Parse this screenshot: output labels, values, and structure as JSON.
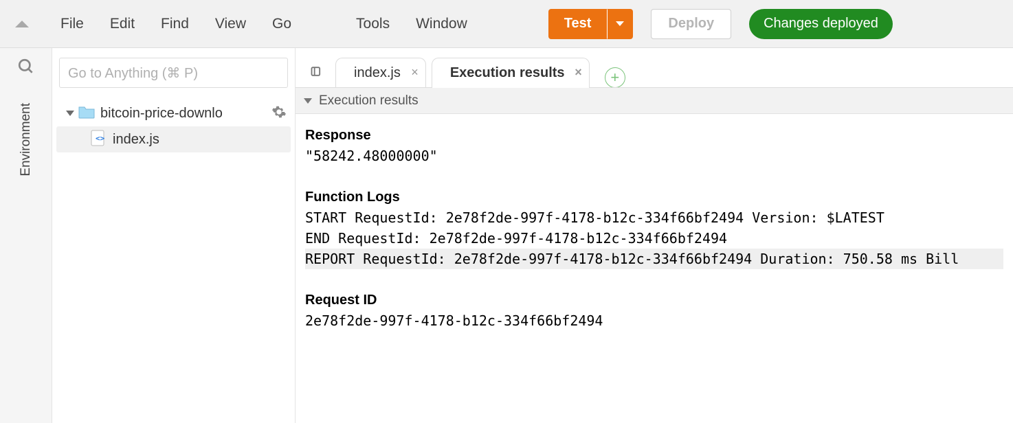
{
  "toolbar": {
    "menus": [
      "File",
      "Edit",
      "Find",
      "View",
      "Go",
      "Tools",
      "Window"
    ],
    "test_label": "Test",
    "deploy_label": "Deploy",
    "status_label": "Changes deployed"
  },
  "sidebar": {
    "tab_label": "Environment",
    "goto_placeholder": "Go to Anything (⌘ P)",
    "tree": {
      "folder": "bitcoin-price-downlo",
      "file": "index.js"
    }
  },
  "tabs": {
    "items": [
      {
        "label": "index.js",
        "active": false
      },
      {
        "label": "Execution results",
        "active": true
      }
    ]
  },
  "panel": {
    "header": "Execution results",
    "response_title": "Response",
    "response_body": "\"58242.48000000\"",
    "logs_title": "Function Logs",
    "logs": [
      "START RequestId: 2e78f2de-997f-4178-b12c-334f66bf2494 Version: $LATEST",
      "END RequestId: 2e78f2de-997f-4178-b12c-334f66bf2494",
      "REPORT RequestId: 2e78f2de-997f-4178-b12c-334f66bf2494  Duration: 750.58 ms Bill"
    ],
    "request_id_title": "Request ID",
    "request_id": "2e78f2de-997f-4178-b12c-334f66bf2494"
  }
}
